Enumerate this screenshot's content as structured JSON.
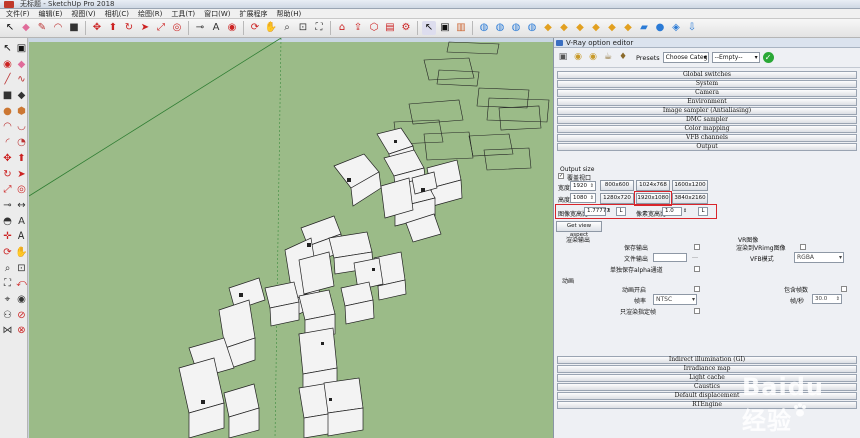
{
  "window": {
    "title": "无标题 - SketchUp Pro 2018"
  },
  "menu": [
    "文件(F)",
    "编辑(E)",
    "视图(V)",
    "相机(C)",
    "绘图(R)",
    "工具(T)",
    "窗口(W)",
    "扩展程序",
    "帮助(H)"
  ],
  "vray": {
    "title": "V-Ray option editor",
    "presets_label": "Presets",
    "preset_category": "Choose Categ",
    "preset_value": "--Empty--",
    "rollouts_top": [
      "Global switches",
      "System",
      "Camera",
      "Environment",
      "Image sampler (Antialiasing)",
      "DMC sampler",
      "Color mapping",
      "VFB channels",
      "Output"
    ],
    "output": {
      "section_title": "Output size",
      "override_label": "覆盖视口",
      "width_label": "宽度",
      "width_value": "1920",
      "height_label": "高度",
      "height_value": "1080",
      "presets": [
        "800x600",
        "1024x768",
        "1600x1200",
        "1280x720",
        "1920x1080",
        "3840x2160"
      ],
      "image_aspect_label": "图像宽高比",
      "image_aspect_value": "1.77777",
      "lock_L": "L",
      "pixel_aspect_label": "像素宽高比",
      "pixel_aspect_value": "1.0",
      "lock_L2": "L",
      "get_view_aspect": "Get view aspect",
      "render_output_label": "渲染输出",
      "save_output": "保存输出",
      "file_output": "文件输出",
      "alpha_separate": "单独保存alpha通道",
      "vfb_header": "VR图像",
      "render_to_vrimg": "渲染到VRimg图像",
      "vfb_mode_label": "VFB模式",
      "vfb_mode_value": "RGBA",
      "animation_label": "动画",
      "animation_on": "动画开启",
      "frame_rate_label": "帧率",
      "frame_rate_value": "NTSC",
      "render_current_frame": "只渲染指定帧",
      "include_frame": "包含帧数",
      "fps_label": "帧/秒",
      "fps_value": "30.0"
    },
    "rollouts_bottom": [
      "Indirect illumination (GI)",
      "Irradiance map",
      "Light cache",
      "Caustics",
      "Default displacement",
      "RTEngine"
    ]
  },
  "watermark": {
    "text": "Baidu 经验"
  },
  "colors": {
    "ground": "#9bbb88",
    "highlight": "#d9252b"
  }
}
